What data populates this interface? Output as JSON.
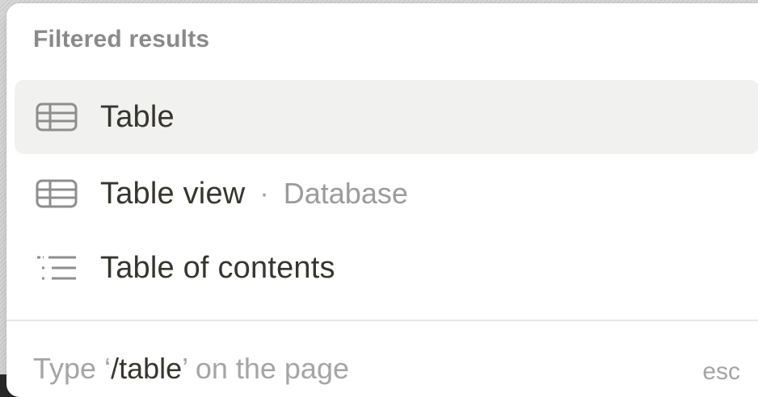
{
  "menu": {
    "section_title": "Filtered results",
    "items": [
      {
        "label": "Table",
        "icon": "table-icon",
        "selected": true
      },
      {
        "label": "Table view",
        "separator": "·",
        "sub": "Database",
        "icon": "table-icon",
        "selected": false
      },
      {
        "label": "Table of contents",
        "icon": "table-of-contents-icon",
        "selected": false
      }
    ],
    "footer": {
      "prefix": "Type ",
      "open_quote": "‘",
      "command": "/table",
      "close_quote": "’",
      "suffix": " on the page",
      "close_label": "esc"
    }
  },
  "colors": {
    "text_primary": "#37352f",
    "text_muted": "#9b9b9b",
    "selected_bg": "#f1f1ef"
  }
}
